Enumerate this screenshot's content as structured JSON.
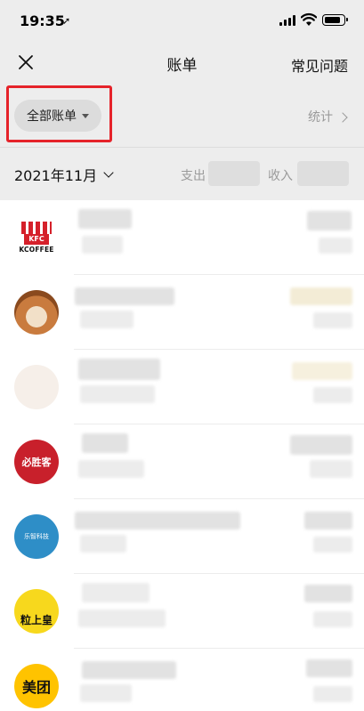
{
  "status_bar": {
    "time": "19:35",
    "location_glyph": "➚"
  },
  "nav": {
    "title": "账单",
    "faq_label": "常见问题"
  },
  "filter": {
    "chip_label": "全部账单",
    "stats_label": "统计"
  },
  "summary": {
    "month": "2021年11月",
    "expense_label": "支出",
    "income_label": "收入"
  },
  "transactions": [
    {
      "merchant_logo_text": "KFC",
      "merchant_logo_sub": "KCOFFEE",
      "icon": "kfc-logo"
    },
    {
      "icon": "dog-avatar"
    },
    {
      "icon": "cat-avatar"
    },
    {
      "merchant_logo_text": "必胜客",
      "icon": "pizza-hut-logo"
    },
    {
      "merchant_logo_text": "乐智科技",
      "icon": "lezhi-logo"
    },
    {
      "merchant_logo_text": "粒上皇",
      "icon": "lishanghuang-logo"
    },
    {
      "merchant_logo_text": "美团",
      "icon": "meituan-logo"
    }
  ],
  "colors": {
    "highlight": "#e5232a",
    "background": "#ededed",
    "secondary_text": "#9a9a9a"
  }
}
